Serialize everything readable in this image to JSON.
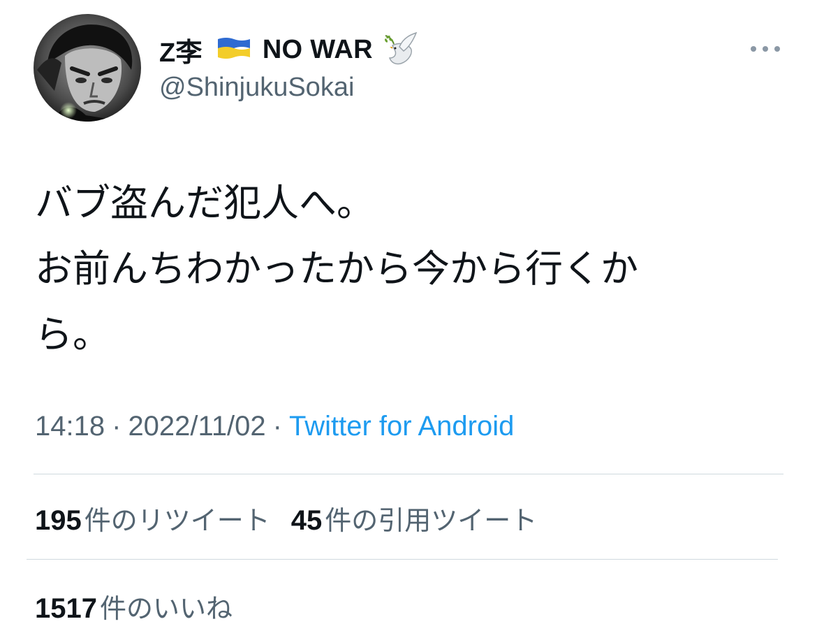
{
  "user": {
    "name_prefix": "Z李",
    "name_suffix": "NO WAR",
    "handle": "@ShinjukuSokai",
    "flag_icon": "ukraine-flag-icon",
    "dove_icon": "dove-icon",
    "flag_colors": [
      "#2f6bd1",
      "#f3cd2a"
    ]
  },
  "tweet": {
    "lines": [
      "バブ盗んだ犯人へ。",
      "お前んちわかったから今から行くか",
      "ら。"
    ]
  },
  "meta": {
    "time": "14:18",
    "separator": "·",
    "date": "2022/11/02",
    "source": "Twitter for Android"
  },
  "stats": {
    "retweets_count": "195",
    "retweets_label": "件のリツイート",
    "quotes_count": "45",
    "quotes_label": "件の引用ツイート",
    "likes_count": "1517",
    "likes_label": "件のいいね"
  },
  "colors": {
    "text": "#0f1419",
    "secondary": "#536471",
    "link": "#1d9bf0",
    "divider": "#cfd9de"
  }
}
